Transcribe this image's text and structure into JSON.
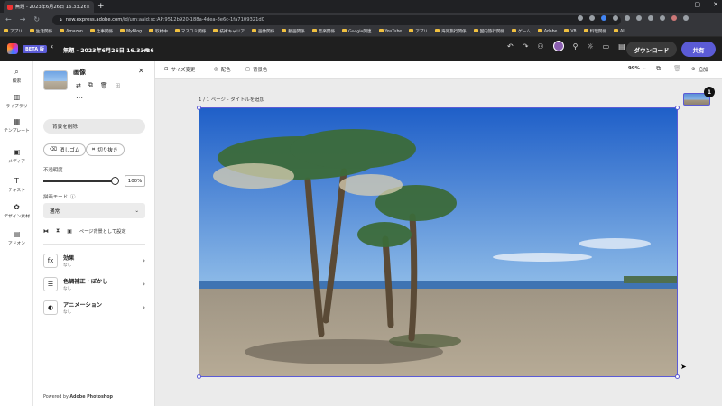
{
  "browser": {
    "tab_title": "無題 - 2023年6月26日 16.33.26",
    "url_host": "new.express.adobe.com",
    "url_path": "/id/urn:aaid:sc:AP:9512b920-188a-4dea-8e6c-1fa7109321d0",
    "bookmarks": [
      "アプリ",
      "生活関係",
      "Amazon",
      "仕事関係",
      "MyBlog",
      "取材中",
      "マスコミ関係",
      "技術キャリア",
      "画像関係",
      "動画関係",
      "音楽関係",
      "Google関連",
      "YouTube",
      "アプリ",
      "海外旅行関係",
      "国内旅行関係",
      "ゲーム",
      "Adobe",
      "VR",
      "料理関係",
      "AI"
    ]
  },
  "app": {
    "beta_label": "BETA 版",
    "doc_title": "無題 - 2023年6月26日 16.33.26",
    "download_label": "ダウンロード",
    "share_label": "共有",
    "accent_color": "#5b5bd6"
  },
  "rail": {
    "items": [
      {
        "label": "検索",
        "icon": "search-icon"
      },
      {
        "label": "ライブラリ",
        "icon": "library-icon"
      },
      {
        "label": "テンプレート",
        "icon": "template-icon"
      },
      {
        "label": "メディア",
        "icon": "media-icon"
      },
      {
        "label": "テキスト",
        "icon": "text-icon"
      },
      {
        "label": "デザイン素材",
        "icon": "design-assets-icon"
      },
      {
        "label": "アドオン",
        "icon": "addons-icon"
      }
    ]
  },
  "panel": {
    "title": "画像",
    "remove_bg": "背景を削除",
    "eraser": "消しゴム",
    "crop": "切り抜き",
    "opacity_label": "不透明度",
    "opacity_value": "100%",
    "opacity_fraction": 1.0,
    "blend_label": "描画モード",
    "blend_value": "通常",
    "set_as_bg": "ページ背景として設定",
    "rows": [
      {
        "title": "効果",
        "sub": "なし",
        "icon": "fx-icon"
      },
      {
        "title": "色調補正・ぼかし",
        "sub": "なし",
        "icon": "adjust-icon"
      },
      {
        "title": "アニメーション",
        "sub": "なし",
        "icon": "animation-icon"
      }
    ],
    "powered_prefix": "Powered by",
    "powered_brand": "Adobe Photoshop"
  },
  "canvas": {
    "resize": "サイズ変更",
    "color": "配色",
    "bg_color": "背景色",
    "zoom": "99%",
    "add": "追加",
    "page_label": "1 / 1 ページ - タイトルを追加",
    "page_count": "1"
  }
}
